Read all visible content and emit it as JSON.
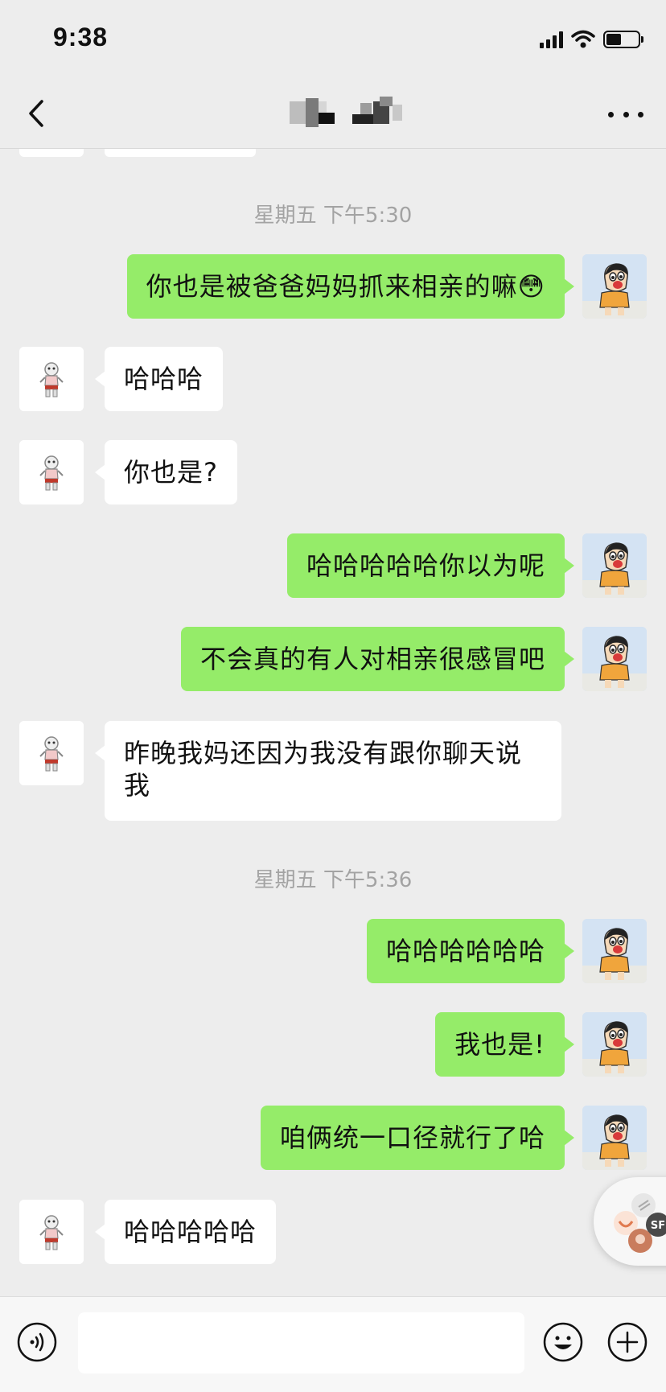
{
  "status": {
    "time": "9:38"
  },
  "nav": {
    "title": "",
    "back_icon": "chevron-left-icon",
    "more_icon": "ellipsis-icon"
  },
  "chat": {
    "timestamps": [
      "星期五 下午5:30",
      "星期五 下午5:36"
    ],
    "messages": [
      {
        "side": "out",
        "text": "你也是被爸爸妈妈抓来相亲的嘛",
        "emoji": "😳"
      },
      {
        "side": "in",
        "text": "哈哈哈"
      },
      {
        "side": "in",
        "text": "你也是?"
      },
      {
        "side": "out",
        "text": "哈哈哈哈哈你以为呢"
      },
      {
        "side": "out",
        "text": "不会真的有人对相亲很感冒吧"
      },
      {
        "side": "in",
        "text": "昨晚我妈还因为我没有跟你聊天说我"
      },
      {
        "side": "out",
        "text": "哈哈哈哈哈哈"
      },
      {
        "side": "out",
        "text": "我也是!"
      },
      {
        "side": "out",
        "text": "咱俩统一口径就行了哈"
      },
      {
        "side": "in",
        "text": "哈哈哈哈哈"
      }
    ]
  },
  "input": {
    "value": "",
    "placeholder": ""
  },
  "colors": {
    "background": "#ededed",
    "outgoing_bubble": "#95ec69",
    "incoming_bubble": "#ffffff",
    "timestamp": "#a3a3a3"
  }
}
